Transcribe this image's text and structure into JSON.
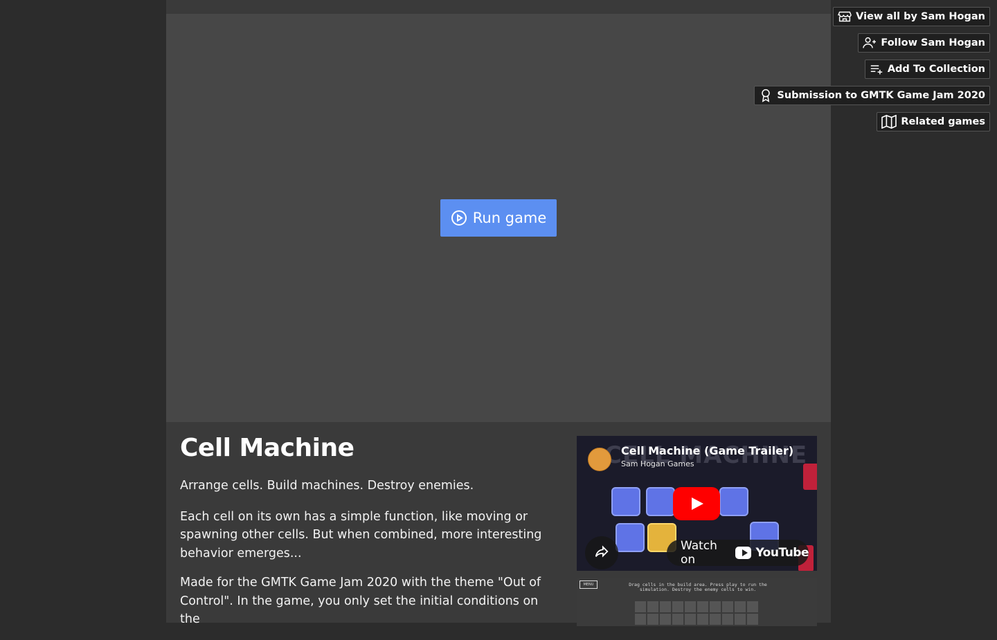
{
  "game": {
    "run_label": "Run game",
    "title": "Cell Machine",
    "tagline": "Arrange cells. Build machines. Destroy enemies.",
    "description_1": "Each cell on its own has a simple function, like moving or spawning other cells. But when combined, more interesting behavior emerges...",
    "description_2": "Made for the GMTK Game Jam 2020 with the theme \"Out of Control\". In the game, you only set the initial conditions on the"
  },
  "video": {
    "title": "Cell Machine (Game Trailer)",
    "channel": "Sam Hogan Games",
    "watch_on": "Watch on",
    "youtube": "YouTube"
  },
  "screenshot": {
    "menu_label": "MENU",
    "instructions": "Drag cells in the build area. Press play to run the simulation. Destroy the enemy cells to win."
  },
  "side_links": {
    "view_all": "View all by Sam Hogan",
    "follow": "Follow Sam Hogan",
    "add_collection": "Add To Collection",
    "submission": "Submission to GMTK Game Jam 2020",
    "related": "Related games"
  },
  "colors": {
    "background": "#2c2c2c",
    "page": "#3a3a3a",
    "run_button": "#5c8ff1",
    "youtube_red": "#ff0000"
  }
}
